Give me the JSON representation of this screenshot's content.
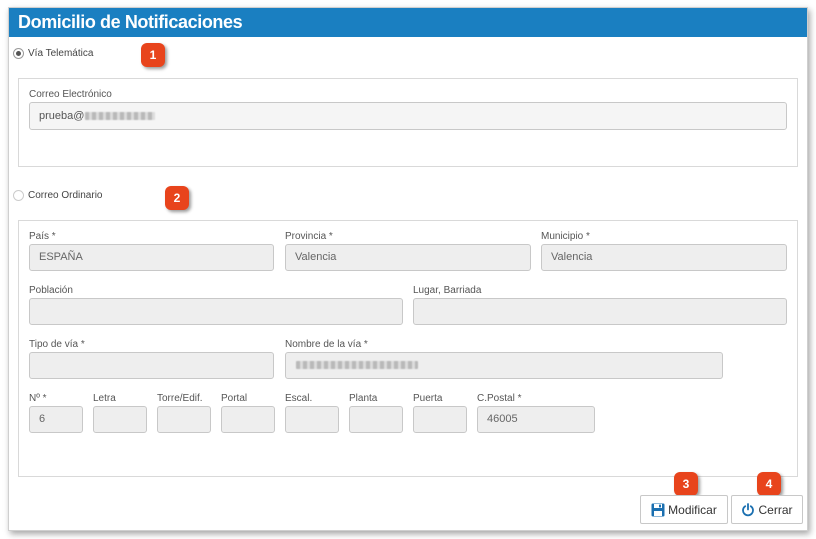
{
  "panel": {
    "title": "Domicilio de Notificaciones"
  },
  "telematica": {
    "radio_label": "Vía Telemática",
    "selected": true,
    "email_label": "Correo Electrónico",
    "email_value": "prueba@"
  },
  "ordinario": {
    "radio_label": "Correo Ordinario",
    "selected": false,
    "fields": {
      "pais": {
        "label": "País *",
        "value": "ESPAÑA"
      },
      "provincia": {
        "label": "Provincia *",
        "value": "Valencia"
      },
      "municipio": {
        "label": "Municipio *",
        "value": "Valencia"
      },
      "poblacion": {
        "label": "Población",
        "value": ""
      },
      "lugar": {
        "label": "Lugar, Barriada",
        "value": ""
      },
      "tipo_via": {
        "label": "Tipo de vía *",
        "value": ""
      },
      "nombre_via": {
        "label": "Nombre de la vía *",
        "value": ""
      },
      "numero": {
        "label": "Nº *",
        "value": "6"
      },
      "letra": {
        "label": "Letra",
        "value": ""
      },
      "torre": {
        "label": "Torre/Edif.",
        "value": ""
      },
      "portal": {
        "label": "Portal",
        "value": ""
      },
      "escalera": {
        "label": "Escal.",
        "value": ""
      },
      "planta": {
        "label": "Planta",
        "value": ""
      },
      "puerta": {
        "label": "Puerta",
        "value": ""
      },
      "cpostal": {
        "label": "C.Postal *",
        "value": "46005"
      }
    }
  },
  "badges": [
    "1",
    "2",
    "3",
    "4"
  ],
  "buttons": {
    "modificar": {
      "label": "Modificar",
      "icon": "save-icon"
    },
    "cerrar": {
      "label": "Cerrar",
      "icon": "power-icon"
    }
  },
  "colors": {
    "header": "#1a7fc1",
    "badge": "#e8441c",
    "icon": "#1a6fb0"
  }
}
